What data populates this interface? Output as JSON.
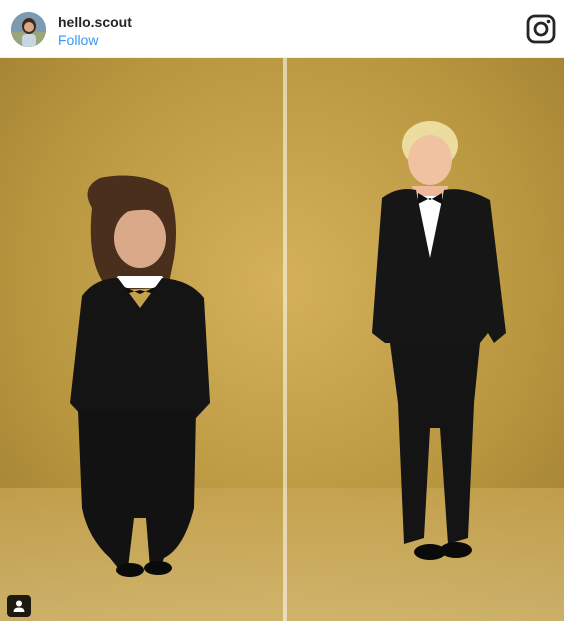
{
  "post": {
    "username": "hello.scout",
    "follow_label": "Follow"
  },
  "icons": {
    "brand": "instagram-icon",
    "tag": "user-tag-icon"
  },
  "colors": {
    "username": "#262626",
    "follow": "#3897f0",
    "background_gold": "#b8963f",
    "suit": "#141414"
  }
}
